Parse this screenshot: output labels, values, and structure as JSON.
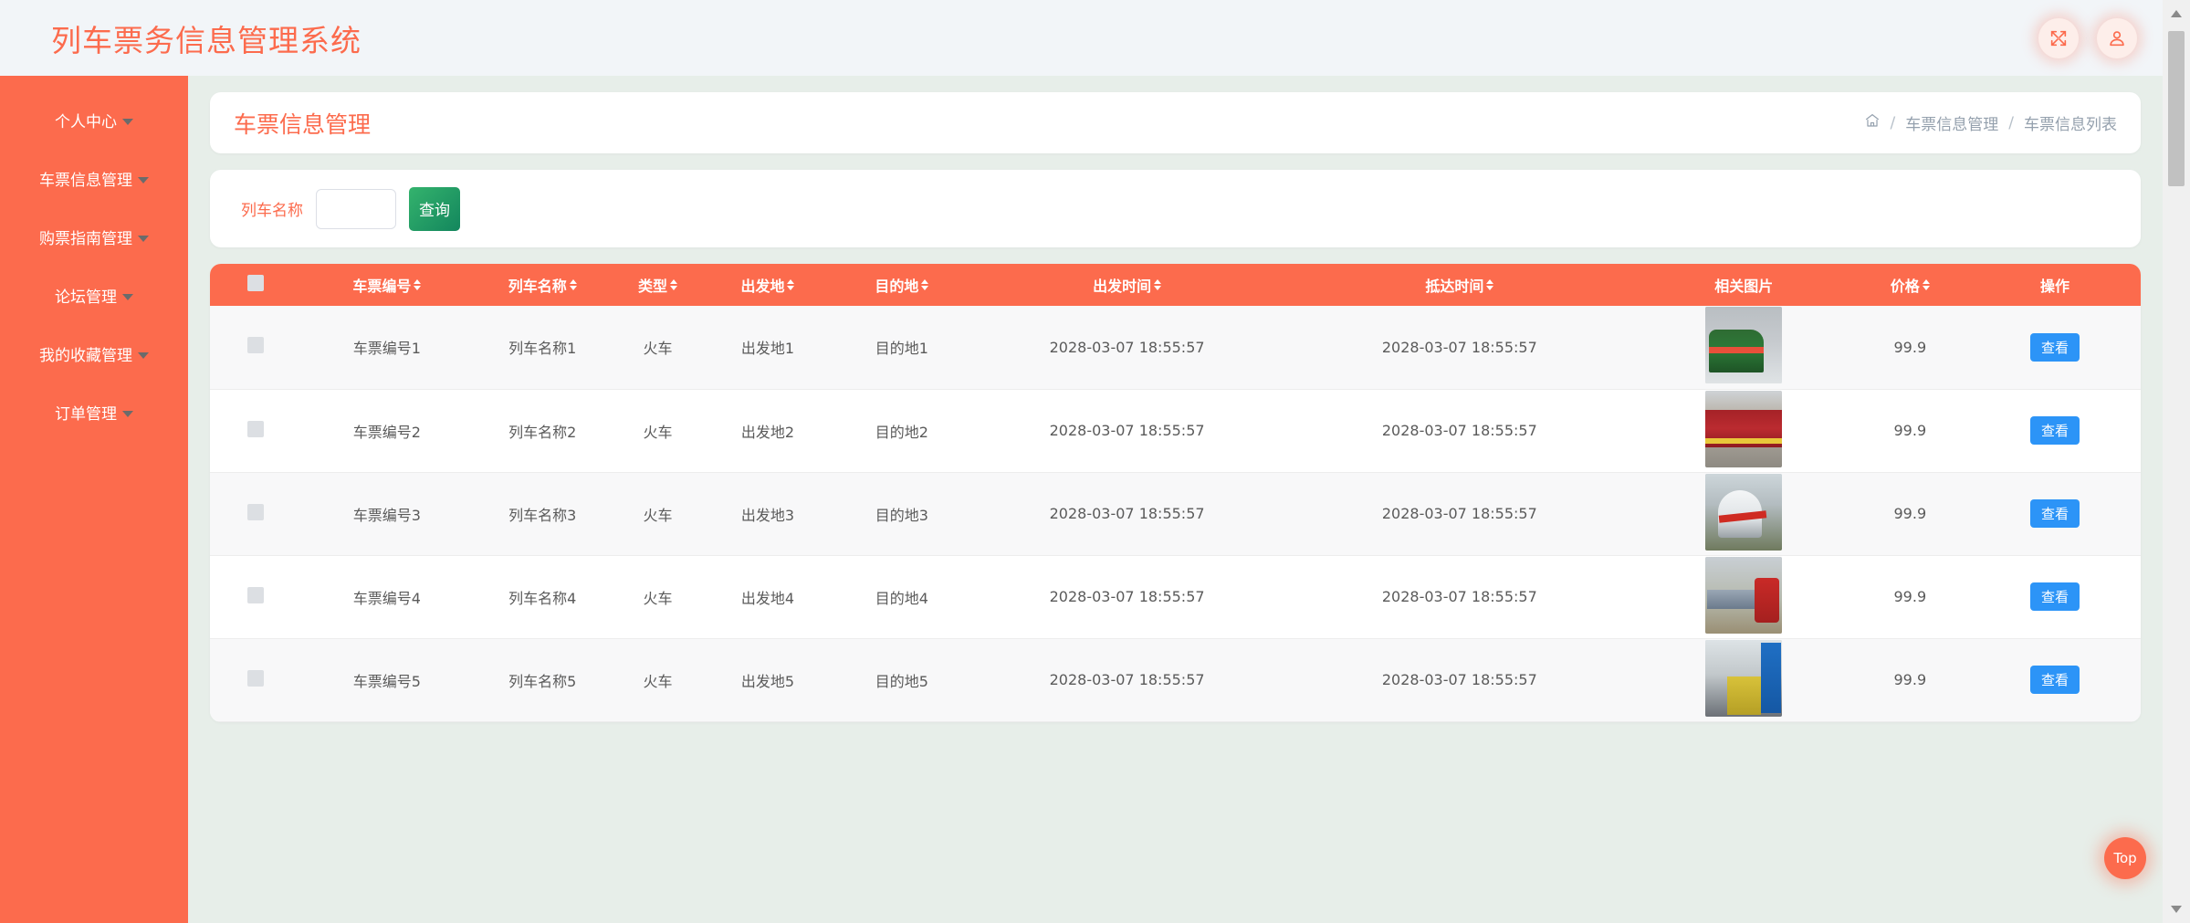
{
  "app": {
    "brand": "列车票务信息管理系统"
  },
  "topbar": {
    "fullscreen_label": "全屏",
    "user_label": "用户"
  },
  "sidebar": {
    "items": [
      {
        "label": "个人中心"
      },
      {
        "label": "车票信息管理"
      },
      {
        "label": "购票指南管理"
      },
      {
        "label": "论坛管理"
      },
      {
        "label": "我的收藏管理"
      },
      {
        "label": "订单管理"
      }
    ]
  },
  "page": {
    "title": "车票信息管理",
    "breadcrumb": {
      "home_icon": "home-icon",
      "sep": "/",
      "items": [
        "车票信息管理",
        "车票信息列表"
      ]
    }
  },
  "search": {
    "label": "列车名称",
    "value": "",
    "placeholder": "",
    "button": "查询"
  },
  "table": {
    "columns": [
      {
        "key": "select",
        "label": "",
        "sortable": false
      },
      {
        "key": "ticket_no",
        "label": "车票编号",
        "sortable": true
      },
      {
        "key": "train",
        "label": "列车名称",
        "sortable": true
      },
      {
        "key": "type",
        "label": "类型",
        "sortable": true
      },
      {
        "key": "origin",
        "label": "出发地",
        "sortable": true
      },
      {
        "key": "dest",
        "label": "目的地",
        "sortable": true
      },
      {
        "key": "depart",
        "label": "出发时间",
        "sortable": true
      },
      {
        "key": "arrive",
        "label": "抵达时间",
        "sortable": true
      },
      {
        "key": "image",
        "label": "相关图片",
        "sortable": false
      },
      {
        "key": "price",
        "label": "价格",
        "sortable": true
      },
      {
        "key": "action",
        "label": "操作",
        "sortable": false
      }
    ],
    "action_label": "查看",
    "rows": [
      {
        "ticket_no": "车票编号1",
        "train": "列车名称1",
        "type": "火车",
        "origin": "出发地1",
        "dest": "目的地1",
        "depart": "2028-03-07 18:55:57",
        "arrive": "2028-03-07 18:55:57",
        "image_alt": "绿色火车头雪地照片",
        "price": "99.9",
        "action": "查看"
      },
      {
        "ticket_no": "车票编号2",
        "train": "列车名称2",
        "type": "火车",
        "origin": "出发地2",
        "dest": "目的地2",
        "depart": "2028-03-07 18:55:57",
        "arrive": "2028-03-07 18:55:57",
        "image_alt": "红色车厢站台照片",
        "price": "99.9",
        "action": "查看"
      },
      {
        "ticket_no": "车票编号3",
        "train": "列车名称3",
        "type": "火车",
        "origin": "出发地3",
        "dest": "目的地3",
        "depart": "2028-03-07 18:55:57",
        "arrive": "2028-03-07 18:55:57",
        "image_alt": "白色动车系红花照片",
        "price": "99.9",
        "action": "查看"
      },
      {
        "ticket_no": "车票编号4",
        "train": "列车名称4",
        "type": "火车",
        "origin": "出发地4",
        "dest": "目的地4",
        "depart": "2028-03-07 18:55:57",
        "arrive": "2028-03-07 18:55:57",
        "image_alt": "红色机车城市背景照片",
        "price": "99.9",
        "action": "查看"
      },
      {
        "ticket_no": "车票编号5",
        "train": "列车名称5",
        "type": "火车",
        "origin": "出发地5",
        "dest": "目的地5",
        "depart": "2028-03-07 18:55:57",
        "arrive": "2028-03-07 18:55:57",
        "image_alt": "中铁车间蓝色标牌照片",
        "price": "99.9",
        "action": "查看"
      }
    ]
  },
  "fab": {
    "top_label": "Top"
  },
  "colors": {
    "brand_orange": "#fc6b4d",
    "content_bg": "#e7eee9",
    "header_bg": "#f2f5f8",
    "search_button_green": "#13865d",
    "view_button_blue": "#2c94f7",
    "breadcrumb_grey": "#94a0ad"
  }
}
